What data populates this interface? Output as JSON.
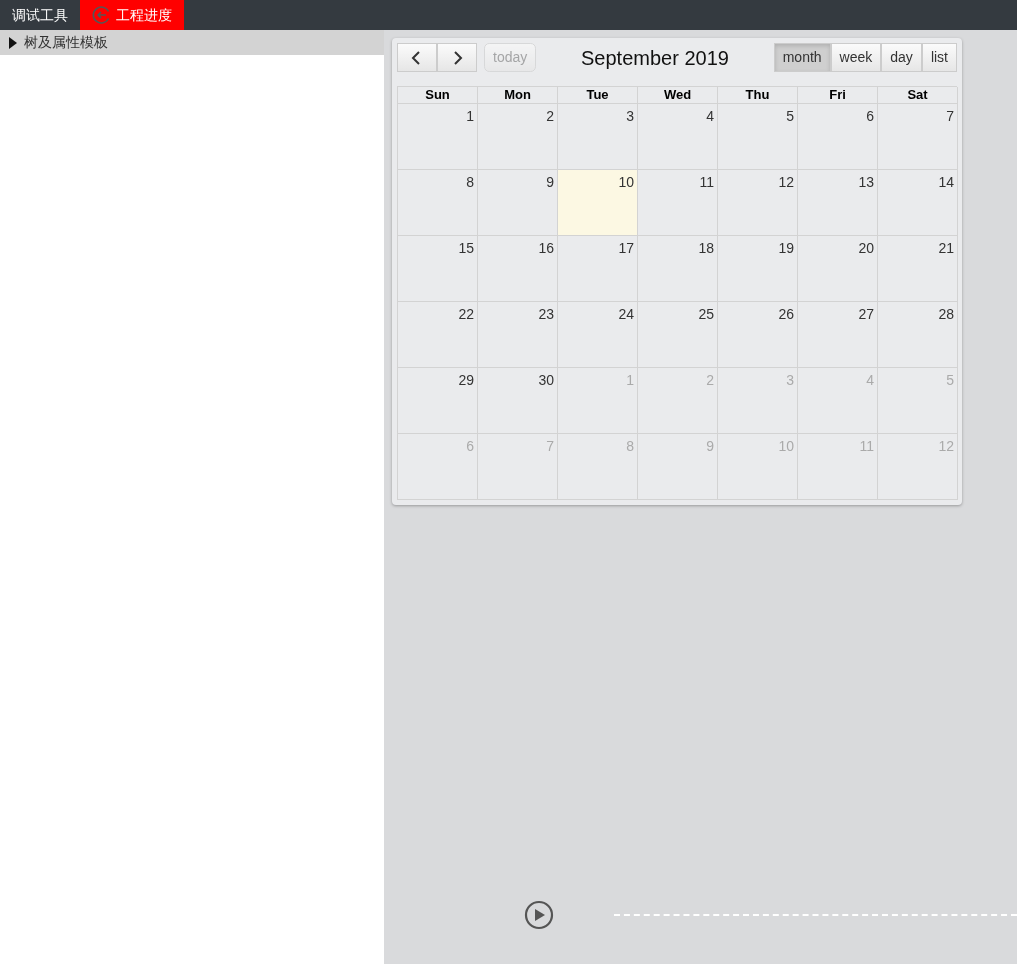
{
  "tabs": [
    {
      "label": "调试工具",
      "selected": false,
      "kind": "plain"
    },
    {
      "label": "工程进度",
      "selected": true,
      "kind": "back"
    }
  ],
  "sidebar": {
    "header": {
      "label": "树及属性模板",
      "expanded": false
    }
  },
  "calendar": {
    "today_button": {
      "label": "today",
      "disabled": true
    },
    "title": "September 2019",
    "views": [
      {
        "label": "month",
        "selected": true
      },
      {
        "label": "week",
        "selected": false
      },
      {
        "label": "day",
        "selected": false
      },
      {
        "label": "list",
        "selected": false
      }
    ],
    "weekdays": [
      "Sun",
      "Mon",
      "Tue",
      "Wed",
      "Thu",
      "Fri",
      "Sat"
    ],
    "weeks": [
      [
        {
          "day": "1",
          "other_month": false,
          "today": false
        },
        {
          "day": "2",
          "other_month": false,
          "today": false
        },
        {
          "day": "3",
          "other_month": false,
          "today": false
        },
        {
          "day": "4",
          "other_month": false,
          "today": false
        },
        {
          "day": "5",
          "other_month": false,
          "today": false
        },
        {
          "day": "6",
          "other_month": false,
          "today": false
        },
        {
          "day": "7",
          "other_month": false,
          "today": false
        }
      ],
      [
        {
          "day": "8",
          "other_month": false,
          "today": false
        },
        {
          "day": "9",
          "other_month": false,
          "today": false
        },
        {
          "day": "10",
          "other_month": false,
          "today": true
        },
        {
          "day": "11",
          "other_month": false,
          "today": false
        },
        {
          "day": "12",
          "other_month": false,
          "today": false
        },
        {
          "day": "13",
          "other_month": false,
          "today": false
        },
        {
          "day": "14",
          "other_month": false,
          "today": false
        }
      ],
      [
        {
          "day": "15",
          "other_month": false,
          "today": false
        },
        {
          "day": "16",
          "other_month": false,
          "today": false
        },
        {
          "day": "17",
          "other_month": false,
          "today": false
        },
        {
          "day": "18",
          "other_month": false,
          "today": false
        },
        {
          "day": "19",
          "other_month": false,
          "today": false
        },
        {
          "day": "20",
          "other_month": false,
          "today": false
        },
        {
          "day": "21",
          "other_month": false,
          "today": false
        }
      ],
      [
        {
          "day": "22",
          "other_month": false,
          "today": false
        },
        {
          "day": "23",
          "other_month": false,
          "today": false
        },
        {
          "day": "24",
          "other_month": false,
          "today": false
        },
        {
          "day": "25",
          "other_month": false,
          "today": false
        },
        {
          "day": "26",
          "other_month": false,
          "today": false
        },
        {
          "day": "27",
          "other_month": false,
          "today": false
        },
        {
          "day": "28",
          "other_month": false,
          "today": false
        }
      ],
      [
        {
          "day": "29",
          "other_month": false,
          "today": false
        },
        {
          "day": "30",
          "other_month": false,
          "today": false
        },
        {
          "day": "1",
          "other_month": true,
          "today": false
        },
        {
          "day": "2",
          "other_month": true,
          "today": false
        },
        {
          "day": "3",
          "other_month": true,
          "today": false
        },
        {
          "day": "4",
          "other_month": true,
          "today": false
        },
        {
          "day": "5",
          "other_month": true,
          "today": false
        }
      ],
      [
        {
          "day": "6",
          "other_month": true,
          "today": false
        },
        {
          "day": "7",
          "other_month": true,
          "today": false
        },
        {
          "day": "8",
          "other_month": true,
          "today": false
        },
        {
          "day": "9",
          "other_month": true,
          "today": false
        },
        {
          "day": "10",
          "other_month": true,
          "today": false
        },
        {
          "day": "11",
          "other_month": true,
          "today": false
        },
        {
          "day": "12",
          "other_month": true,
          "today": false
        }
      ]
    ]
  }
}
